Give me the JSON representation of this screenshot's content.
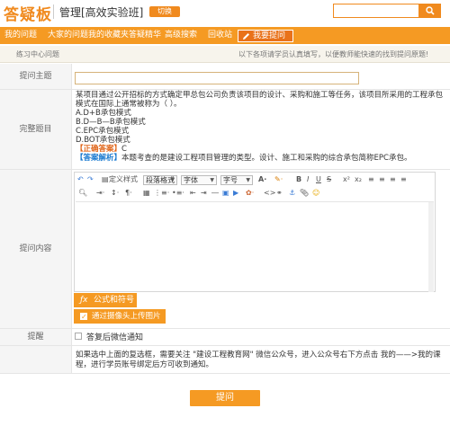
{
  "header": {
    "logo": "答疑板",
    "course_title": "管理[高效实验班]",
    "switch_label": "切换",
    "search": {
      "value": "",
      "placeholder": ""
    }
  },
  "nav": {
    "items": [
      "我的问题",
      "大家的问题我的收藏夹",
      "答疑精华",
      "高级搜索",
      "回收站"
    ],
    "ask_label": "我要提问"
  },
  "subbar": {
    "breadcrumb": "练习中心问题",
    "notice": "以下各项请学员认真填写，以便教师能快速的找到提问原题!"
  },
  "form": {
    "subject_label": "提问主题",
    "subject_value": "",
    "question_label": "完整题目",
    "question": {
      "stem": "某项目通过公开招标的方式确定甲总包公司负责该项目的设计、采购和施工等任务，该项目所采用的工程承包模式在国际上通常被称为（  ）。",
      "options": [
        "A.D+B承包模式",
        "B.D—B—B承包模式",
        "C.EPC承包模式",
        "D.BOT承包模式"
      ],
      "answer_tag": "【正确答案】",
      "answer": "C",
      "analysis_tag": "【答案解析】",
      "analysis": "本题考查的是建设工程项目管理的类型。设计、施工和采购的综合承包简称EPC承包。"
    },
    "content_label": "提问内容",
    "editor": {
      "source_label": "定义样式",
      "paragraph_select": "段落格式",
      "font_select": "字体",
      "size_select": "字号"
    },
    "formula_label": "公式和符号",
    "upload_label": "通过摄像头上传图片",
    "remind_label": "提醒",
    "wechat_label": "答复后微信通知",
    "tip": "如果选中上面的复选框，需要关注 \"建设工程教育网\" 微信公众号，进入公众号右下方点击 我的——>我的课程，进行学员账号绑定后方可收到通知。",
    "submit_label": "提问"
  },
  "colors": {
    "accent": "#f59a23",
    "logo": "#f08a1e",
    "answer": "#e0661a",
    "analysis": "#1a7ad0"
  }
}
